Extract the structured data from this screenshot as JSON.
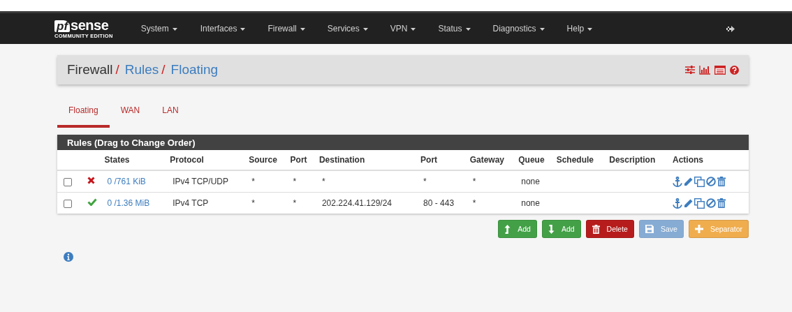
{
  "brand": {
    "prefix": "pf",
    "name": "sense",
    "edition": "COMMUNITY EDITION"
  },
  "nav": [
    "System",
    "Interfaces",
    "Firewall",
    "Services",
    "VPN",
    "Status",
    "Diagnostics",
    "Help"
  ],
  "breadcrumb": [
    {
      "label": "Firewall",
      "link": false,
      "separator": "/"
    },
    {
      "label": "Rules",
      "link": true,
      "separator": "/"
    },
    {
      "label": "Floating",
      "link": true
    }
  ],
  "tabs": [
    {
      "label": "Floating",
      "selected": true
    },
    {
      "label": "WAN",
      "selected": false
    },
    {
      "label": "LAN",
      "selected": false
    }
  ],
  "panel": {
    "title": "Rules (Drag to Change Order)",
    "columns": [
      "States",
      "Protocol",
      "Source",
      "Port",
      "Destination",
      "Port",
      "Gateway",
      "Queue",
      "Schedule",
      "Description",
      "Actions"
    ],
    "rows": [
      {
        "checked": false,
        "blocked": true,
        "states": "0 /761 KiB",
        "protocol": "IPv4 TCP/UDP",
        "source": "*",
        "source_port": "*",
        "destination": "*",
        "destination_port": "*",
        "gateway": "*",
        "queue": "none"
      },
      {
        "checked": false,
        "blocked": false,
        "states": "0 /1.36 MiB",
        "protocol": "IPv4 TCP",
        "source": "*",
        "source_port": "*",
        "destination": "202.224.41.129/24",
        "destination_port": "80 - 443",
        "gateway": "*",
        "queue": "none"
      }
    ]
  },
  "buttons": [
    {
      "kind": "add-top",
      "label": "Add",
      "disabled": false
    },
    {
      "kind": "add-bottom",
      "label": "Add",
      "disabled": false
    },
    {
      "kind": "delete",
      "label": "Delete",
      "disabled": false
    },
    {
      "kind": "save",
      "label": "Save",
      "disabled": true
    },
    {
      "kind": "separator",
      "label": "Separator",
      "disabled": false
    }
  ]
}
